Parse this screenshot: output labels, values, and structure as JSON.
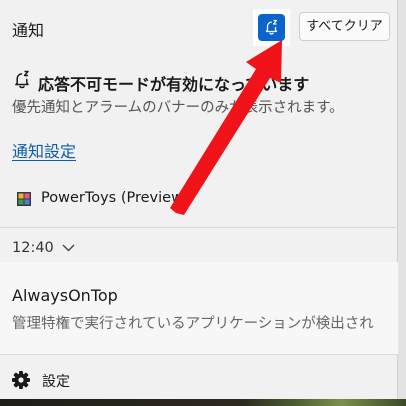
{
  "header": {
    "title": "通知",
    "clear_all_label": "すべてクリア"
  },
  "dnd": {
    "title": "応答不可モードが有効になっています",
    "description": "優先通知とアラームのバナーのみが表示されます。"
  },
  "notification_settings_link": "通知設定",
  "app_group": {
    "name": "PowerToys (Preview)"
  },
  "time_group": {
    "time": "12:40"
  },
  "notification": {
    "title": "AlwaysOnTop",
    "body": "管理特権で実行されているアプリケーションが検出され"
  },
  "footer": {
    "settings_label": "設定"
  },
  "colors": {
    "accent": "#0a64c9",
    "annotation_arrow": "#f0131a"
  }
}
